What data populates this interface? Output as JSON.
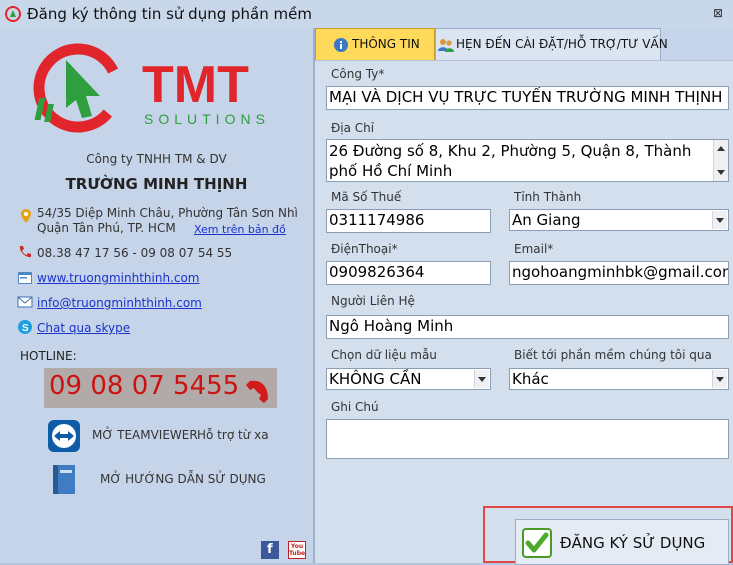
{
  "window": {
    "title": "Đăng ký thông tin sử dụng phần mềm",
    "close_glyph": "⊠"
  },
  "left": {
    "logo": {
      "brand": "TMT",
      "sub": "SOLUTIONS"
    },
    "company": {
      "line1": "Công ty TNHH TM & DV",
      "line2": "TRƯỜNG MINH THỊNH"
    },
    "address": {
      "line1": "54/35 Diệp Minh Châu, Phường Tân Sơn Nhì",
      "line2": "Quận Tân Phú, TP. HCM",
      "map_link": "Xem trên bản đồ"
    },
    "phone": "08.38 47 17 56 - 09 08 07 54 55",
    "website": "www.truongminhthinh.com",
    "email": "info@truongminhthinh.com",
    "skype": "Chat qua skype",
    "hotline": {
      "label": "HOTLINE:",
      "number": "09 08 07 5455"
    },
    "teamviewer": {
      "label": "MỞ TEAMVIEWER",
      "sub": "Hỗ trợ từ xa"
    },
    "manual": {
      "label": "MỞ HƯỚNG DẪN SỬ DỤNG"
    },
    "social": {
      "fb": "f",
      "yt": "You Tube"
    }
  },
  "tabs": [
    {
      "label": "THÔNG TIN",
      "active": true
    },
    {
      "label": "HẸN ĐẾN CÀI ĐẶT/HỖ TRỢ/TƯ VẤN",
      "active": false
    }
  ],
  "form": {
    "company": {
      "label": "Công Ty*",
      "value": "MẠI VÀ DỊCH VỤ TRỰC TUYẾN TRƯỜNG MINH THỊNH"
    },
    "address": {
      "label": "Địa Chỉ",
      "value": "26 Đường số 8, Khu 2, Phường 5, Quận 8, Thành phố Hồ Chí Minh"
    },
    "tax": {
      "label": "Mã Số Thuế",
      "value": "0311174986"
    },
    "province": {
      "label": "Tỉnh Thành",
      "value": "An Giang"
    },
    "phone": {
      "label": "ĐiệnThoại*",
      "value": "0909826364"
    },
    "email": {
      "label": "Email*",
      "value": "ngohoangminhbk@gmail.com"
    },
    "contact": {
      "label": "Người Liên Hệ",
      "value": "Ngô Hoàng Minh"
    },
    "sample": {
      "label": "Chọn dữ liệu mẫu",
      "value": "KHÔNG CẦN"
    },
    "source": {
      "label": "Biết tới phần mềm chúng tôi qua",
      "value": "Khác"
    },
    "note": {
      "label": "Ghi Chú",
      "value": ""
    }
  },
  "register_label": "ĐĂNG KÝ SỬ DỤNG",
  "colors": {
    "brand_red": "#e0262b",
    "accent_yellow": "#ffd95a",
    "hotline_red": "#cc1111",
    "link_blue": "#1a33cc"
  }
}
